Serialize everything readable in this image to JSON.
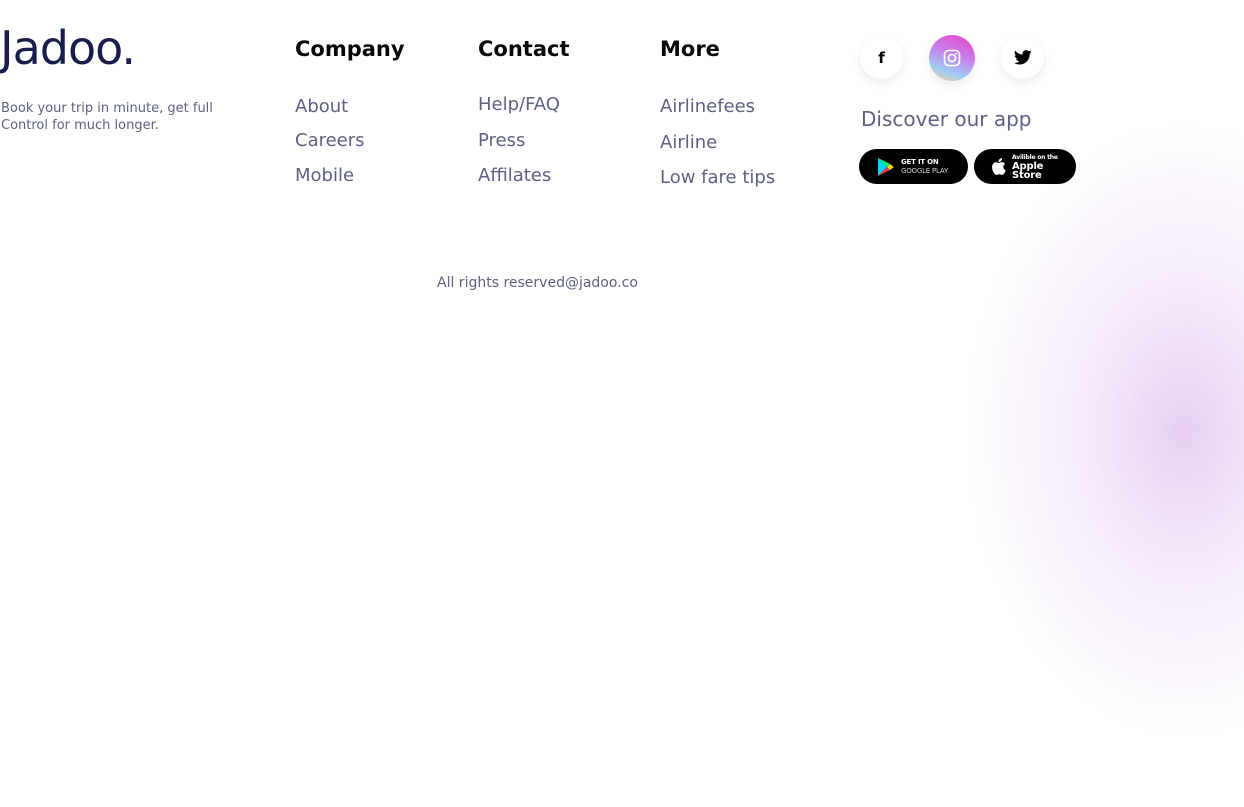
{
  "brand": {
    "logo": "Jadoo.",
    "tagline": "Book your trip in minute, get full Control for much longer."
  },
  "columns": [
    {
      "title": "Company",
      "links": [
        "About",
        "Careers",
        "Mobile"
      ]
    },
    {
      "title": "Contact",
      "links": [
        "Help/FAQ",
        "Press",
        "Affilates"
      ]
    },
    {
      "title": "More",
      "links": [
        "Airlinefees",
        "Airline",
        "Low fare tips"
      ]
    }
  ],
  "social": {
    "icons": [
      "facebook-icon",
      "instagram-icon",
      "twitter-icon"
    ],
    "facebook_glyph": "f"
  },
  "app": {
    "discover_label": "Discover our app",
    "google_play": {
      "line1": "GET IT ON",
      "line2": "GOOGLE PLAY"
    },
    "apple_store": {
      "line1": "Avilible on the",
      "line2": "Apple Store"
    }
  },
  "footer": {
    "copyright": "All rights reserved@jadoo.co"
  },
  "colors": {
    "primary_text": "#181e4b",
    "secondary_text": "#5e6282",
    "heading": "#080809",
    "glow": "#dfc0f0"
  }
}
